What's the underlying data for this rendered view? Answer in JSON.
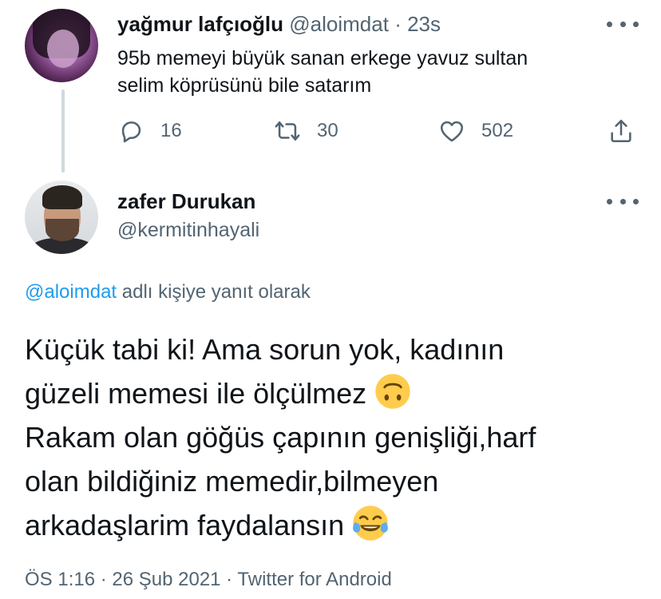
{
  "tweet1": {
    "display_name": "yağmur lafçıoğlu",
    "handle": "@aloimdat",
    "separator": "·",
    "time": "23s",
    "text_line1": "95b memeyi büyük sanan erkege yavuz sultan",
    "text_line2": "selim köprüsünü bile satarım",
    "reply_count": "16",
    "retweet_count": "30",
    "like_count": "502"
  },
  "tweet2": {
    "display_name": "zafer Durukan",
    "handle": "@kermitinhayali",
    "reply_mention": "@aloimdat",
    "reply_suffix": " adlı kişiye yanıt olarak",
    "lines": [
      "Küçük tabi ki! Ama sorun yok, kadının",
      "güzeli memesi ile ölçülmez",
      "Rakam olan göğüs çapının genişliği,harf",
      "olan bildiğiniz memedir,bilmeyen",
      "arkadaşlarim faydalansın"
    ],
    "meta": "ÖS 1:16 · 26 Şub 2021 · Twitter for Android"
  },
  "icons": {
    "more": "more-horizontal-icon",
    "reply": "reply-icon",
    "retweet": "retweet-icon",
    "like": "heart-icon",
    "share": "share-icon",
    "emoji1": "upside-down-face-emoji",
    "emoji2": "tears-of-joy-emoji"
  },
  "colors": {
    "link": "#1d9bf0",
    "secondary_text": "#536471",
    "primary_text": "#0f1419",
    "thread_line": "#cfd9de"
  }
}
